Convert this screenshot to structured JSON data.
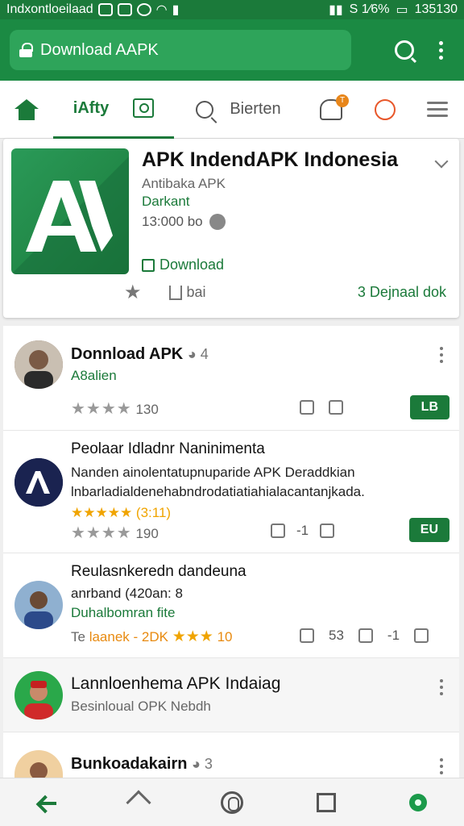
{
  "status_bar": {
    "left_text": "Indxontloeilaad",
    "right_text": "S 1⁄6%",
    "time": "135130"
  },
  "url_bar": {
    "url_text": "Download AAPK"
  },
  "tabs": [
    {
      "label": "",
      "icon": "home-icon"
    },
    {
      "label": "iAfty",
      "icon": ""
    },
    {
      "label": "",
      "icon": "image-icon"
    },
    {
      "label": "",
      "icon": "search-icon"
    },
    {
      "label": "Bierten",
      "icon": ""
    },
    {
      "label": "T",
      "icon": "bell-icon"
    },
    {
      "label": "",
      "icon": "chat-icon"
    },
    {
      "label": "",
      "icon": "menu-icon"
    }
  ],
  "app": {
    "title": "APK IndendAPK Indonesia",
    "subtitle": "Antibaka APK",
    "developer": "Darkant",
    "size": "13:000 bo",
    "download_label": "Download",
    "share_label": "bai",
    "right_label": "3  Dejnaal dok"
  },
  "reviews": [
    {
      "name": "Donnload APK",
      "count": "4",
      "sub": "A8alien",
      "rating_stars": "★★★★",
      "rating_count": "130",
      "pill_label": "LB"
    },
    {
      "name": "Peolaar Idladnr Naninimenta",
      "text": "Nanden ainolentatupnuparide APK Deraddkian lnbarladialdenehabndrodatiatiahialacantanjkada.",
      "gold_rating": "★★★★★ (3:11)",
      "rating_stars": "★★★★",
      "rating_count": "190",
      "action_count": "-1",
      "pill_label": "EU"
    },
    {
      "name": "Reulasnkeredn dandeuna",
      "line1": "anrband (420an: 8",
      "line2": "Duhalbomran fite",
      "gray_prefix": "Te",
      "gold_label": "laanek - 2DK",
      "gold_stars": "★★★",
      "gold_count": "10",
      "count_a": "53",
      "count_b": "-1"
    },
    {
      "name": "Lannloenhema APK Indaiag",
      "sub": "Besinloual OPK Nebdh"
    },
    {
      "name": "Bunkoadakairn",
      "count": "3"
    }
  ]
}
